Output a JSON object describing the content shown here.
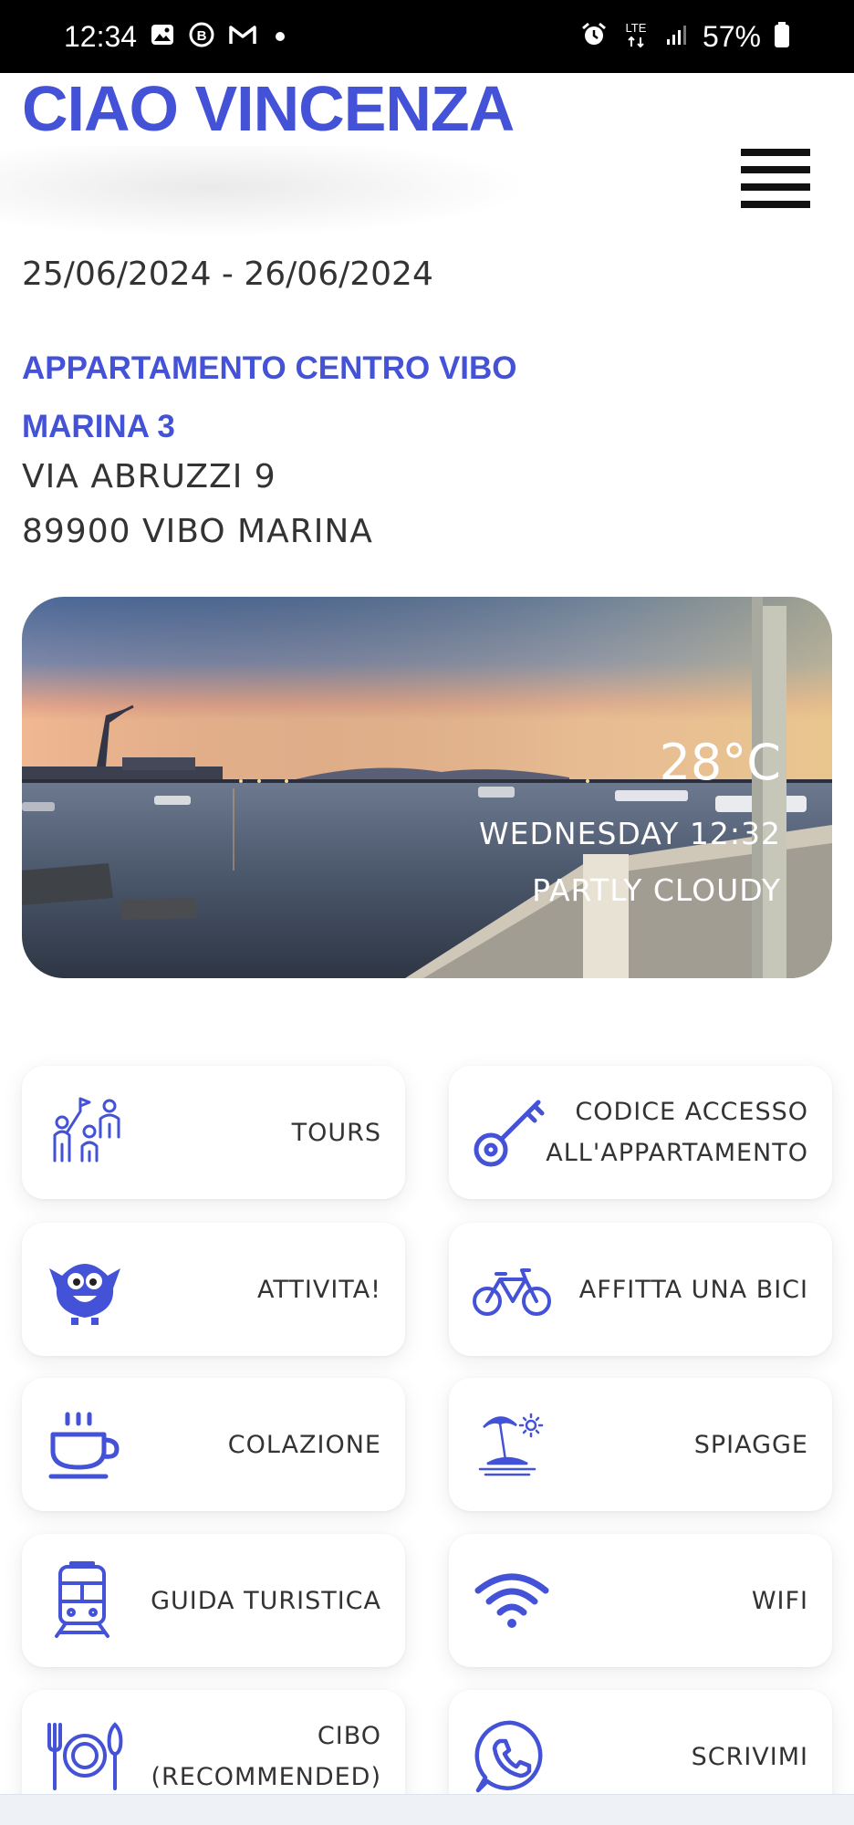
{
  "status_bar": {
    "time": "12:34",
    "battery": "57%",
    "network": "LTE",
    "left_icons": [
      "gallery-icon",
      "b-circle-icon",
      "gmail-icon",
      "dot-icon"
    ],
    "right_icons": [
      "alarm-icon",
      "lte-icon",
      "signal-icon",
      "battery-icon"
    ]
  },
  "header": {
    "brand": "CIAO VINCENZA"
  },
  "booking": {
    "dates": "25/06/2024 - 26/06/2024",
    "apartment_line1": "APPARTAMENTO CENTRO VIBO",
    "apartment_line2": "MARINA 3",
    "street": "VIA ABRUZZI 9",
    "city": "89900 VIBO MARINA"
  },
  "weather": {
    "temperature": "28°C",
    "day_time": "WEDNESDAY 12:32",
    "condition": "PARTLY CLOUDY"
  },
  "tiles": [
    {
      "label": "TOURS",
      "icon": "tour-group-icon"
    },
    {
      "label": "CODICE ACCESSO ALL'APPARTAMENTO",
      "icon": "key-icon"
    },
    {
      "label": "ATTIVITA!",
      "icon": "monster-icon"
    },
    {
      "label": "AFFITTA UNA BICI",
      "icon": "bicycle-icon"
    },
    {
      "label": "COLAZIONE",
      "icon": "coffee-cup-icon"
    },
    {
      "label": "SPIAGGE",
      "icon": "beach-umbrella-icon"
    },
    {
      "label": "GUIDA TURISTICA",
      "icon": "train-icon"
    },
    {
      "label": "WIFI",
      "icon": "wifi-icon"
    },
    {
      "label": "CIBO (RECOMMENDED)",
      "icon": "plate-cutlery-icon"
    },
    {
      "label": "SCRIVIMI",
      "icon": "whatsapp-icon"
    }
  ],
  "colors": {
    "accent": "#4352d6",
    "text": "#333333",
    "status_bar": "#000000"
  }
}
